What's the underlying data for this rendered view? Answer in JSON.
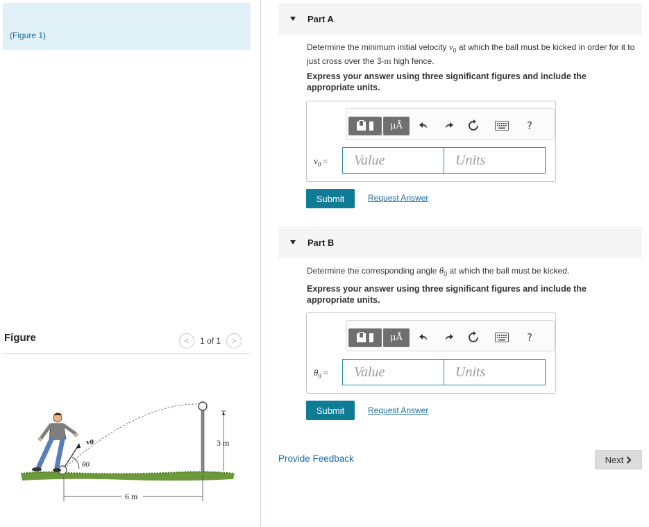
{
  "figure_panel": {
    "link_text": "(Figure 1)",
    "heading": "Figure",
    "pager_text": "1 of 1",
    "prev_symbol": "<",
    "next_symbol": ">",
    "diagram": {
      "velocity_label": "v0",
      "angle_label": "θ0",
      "height_label": "3 m",
      "distance_label": "6 m"
    }
  },
  "toolbar_labels": {
    "units": "μÅ",
    "help": "?"
  },
  "part_a": {
    "title": "Part A",
    "question_prefix": "Determine the minimum initial velocity ",
    "question_var": "v",
    "question_sub": "0",
    "question_mid": " at which the ball must be kicked in order for it to just cross over the 3-",
    "question_unit": "m",
    "question_suffix": " high fence.",
    "instruction": "Express your answer using three significant figures and include the appropriate units.",
    "var_symbol": "v",
    "var_sub": "0",
    "equals": " =",
    "value_placeholder": "Value",
    "units_placeholder": "Units",
    "submit_label": "Submit",
    "request_label": "Request Answer"
  },
  "part_b": {
    "title": "Part B",
    "question_prefix": "Determine the corresponding angle ",
    "question_var": "θ",
    "question_sub": "0",
    "question_suffix": " at which the ball must be kicked.",
    "instruction": "Express your answer using three significant figures and include the appropriate units.",
    "var_symbol": "θ",
    "var_sub": "0",
    "equals": " =",
    "value_placeholder": "Value",
    "units_placeholder": "Units",
    "submit_label": "Submit",
    "request_label": "Request Answer"
  },
  "footer": {
    "feedback_label": "Provide Feedback",
    "next_label": "Next"
  }
}
